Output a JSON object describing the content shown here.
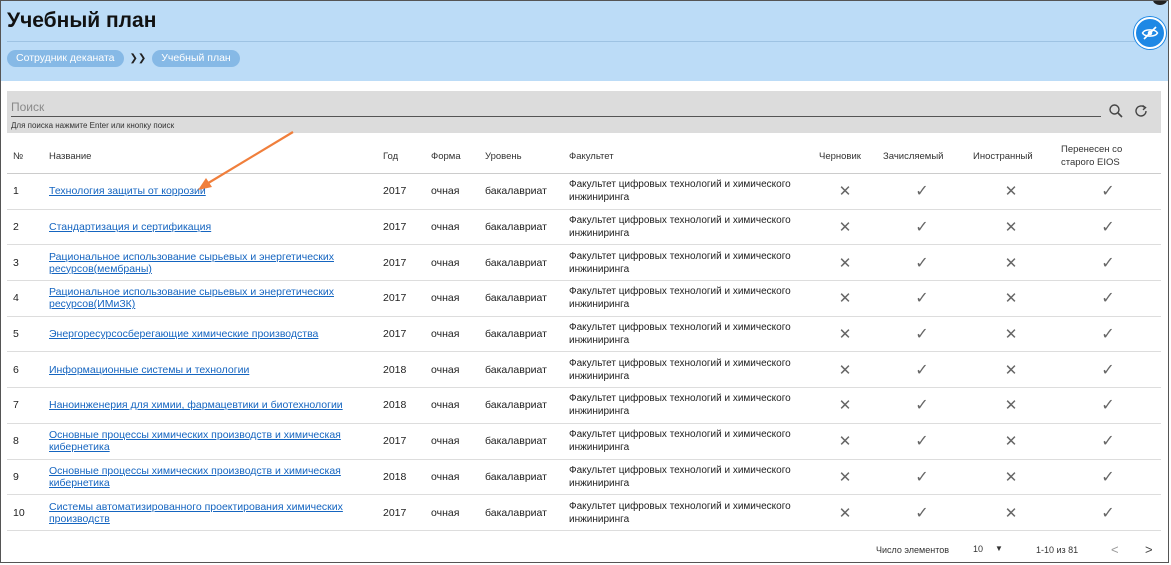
{
  "header": {
    "title": "Учебный план",
    "breadcrumb": [
      "Сотрудник деканата",
      "Учебный план"
    ],
    "breadcrumb_sep": "❯❯"
  },
  "search": {
    "placeholder": "Поиск",
    "hint": "Для поиска нажмите Enter или кнопку поиск"
  },
  "table": {
    "columns": [
      "№",
      "Название",
      "Год",
      "Форма",
      "Уровень",
      "Факультет",
      "Черновик",
      "Зачисляемый",
      "Иностранный",
      "Перенесен со старого EIOS"
    ],
    "rows": [
      {
        "num": "1",
        "name": "Технология защиты от коррозии",
        "year": "2017",
        "form": "очная",
        "level": "бакалавриат",
        "faculty": "Факультет цифровых технологий и химического инжиниринга",
        "draft": "x",
        "credit": "check",
        "foreign": "x",
        "migrated": "check"
      },
      {
        "num": "2",
        "name": "Стандартизация и сертификация",
        "year": "2017",
        "form": "очная",
        "level": "бакалавриат",
        "faculty": "Факультет цифровых технологий и химического инжиниринга",
        "draft": "x",
        "credit": "check",
        "foreign": "x",
        "migrated": "check"
      },
      {
        "num": "3",
        "name": "Рациональное использование сырьевых и энергетических ресурсов(мембраны)",
        "year": "2017",
        "form": "очная",
        "level": "бакалавриат",
        "faculty": "Факультет цифровых технологий и химического инжиниринга",
        "draft": "x",
        "credit": "check",
        "foreign": "x",
        "migrated": "check"
      },
      {
        "num": "4",
        "name": "Рациональное использование сырьевых и энергетических ресурсов(ИМиЗК)",
        "year": "2017",
        "form": "очная",
        "level": "бакалавриат",
        "faculty": "Факультет цифровых технологий и химического инжиниринга",
        "draft": "x",
        "credit": "check",
        "foreign": "x",
        "migrated": "check"
      },
      {
        "num": "5",
        "name": "Энергоресурсосберегающие химические производства",
        "year": "2017",
        "form": "очная",
        "level": "бакалавриат",
        "faculty": "Факультет цифровых технологий и химического инжиниринга",
        "draft": "x",
        "credit": "check",
        "foreign": "x",
        "migrated": "check"
      },
      {
        "num": "6",
        "name": "Информационные системы и технологии",
        "year": "2018",
        "form": "очная",
        "level": "бакалавриат",
        "faculty": "Факультет цифровых технологий и химического инжиниринга",
        "draft": "x",
        "credit": "check",
        "foreign": "x",
        "migrated": "check"
      },
      {
        "num": "7",
        "name": "Наноинженерия для химии, фармацевтики и биотехнологии",
        "year": "2018",
        "form": "очная",
        "level": "бакалавриат",
        "faculty": "Факультет цифровых технологий и химического инжиниринга",
        "draft": "x",
        "credit": "check",
        "foreign": "x",
        "migrated": "check"
      },
      {
        "num": "8",
        "name": "Основные процессы химических производств и химическая кибернетика",
        "year": "2017",
        "form": "очная",
        "level": "бакалавриат",
        "faculty": "Факультет цифровых технологий и химического инжиниринга",
        "draft": "x",
        "credit": "check",
        "foreign": "x",
        "migrated": "check"
      },
      {
        "num": "9",
        "name": "Основные процессы химических производств и химическая кибернетика",
        "year": "2018",
        "form": "очная",
        "level": "бакалавриат",
        "faculty": "Факультет цифровых технологий и химического инжиниринга",
        "draft": "x",
        "credit": "check",
        "foreign": "x",
        "migrated": "check"
      },
      {
        "num": "10",
        "name": "Системы автоматизированного проектирования химических производств",
        "year": "2017",
        "form": "очная",
        "level": "бакалавриат",
        "faculty": "Факультет цифровых технологий и химического инжиниринга",
        "draft": "x",
        "credit": "check",
        "foreign": "x",
        "migrated": "check"
      }
    ]
  },
  "pager": {
    "items_label": "Число элементов",
    "page_size": "10",
    "range": "1-10 из 81"
  },
  "icons": {
    "true_glyph": "✓",
    "false_glyph": "✕"
  },
  "colors": {
    "header_bg": "#bcdcf7",
    "link": "#1565c0",
    "accent": "#1e88e5",
    "annotation_arrow": "#f07f3c"
  }
}
